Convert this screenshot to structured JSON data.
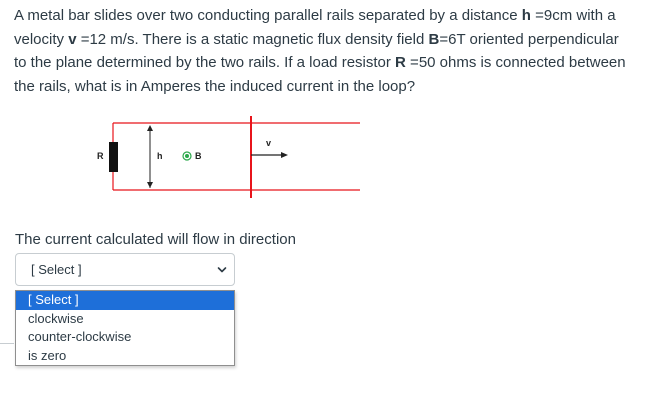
{
  "question": {
    "text_1": "A metal bar slides over two conducting parallel rails separated by a distance ",
    "h_label": "h",
    "text_2": " =9cm with a velocity ",
    "v_label": "v",
    "text_3": " =12 m/s.  There is a static magnetic flux density field ",
    "b_label": "B",
    "text_4": "=6T oriented perpendicular to the plane determined by the two rails.  If a load resistor ",
    "r_label": "R",
    "text_5": " =50 ohms is connected between the rails, what is in Amperes the induced current in the loop?"
  },
  "diagram": {
    "label_r": "R",
    "label_h": "h",
    "label_b": "B",
    "label_v": "v",
    "rail_color": "#e8141b",
    "resistor_color": "#111111",
    "field_dot_color": "#2aa84a"
  },
  "prompt": {
    "text": "The current calculated will flow in direction"
  },
  "select": {
    "value": "[ Select ]",
    "options": [
      "[ Select ]",
      "clockwise",
      "counter-clockwise",
      "is zero"
    ],
    "highlighted_index": 0,
    "highlight_color": "#1e6fd9"
  }
}
